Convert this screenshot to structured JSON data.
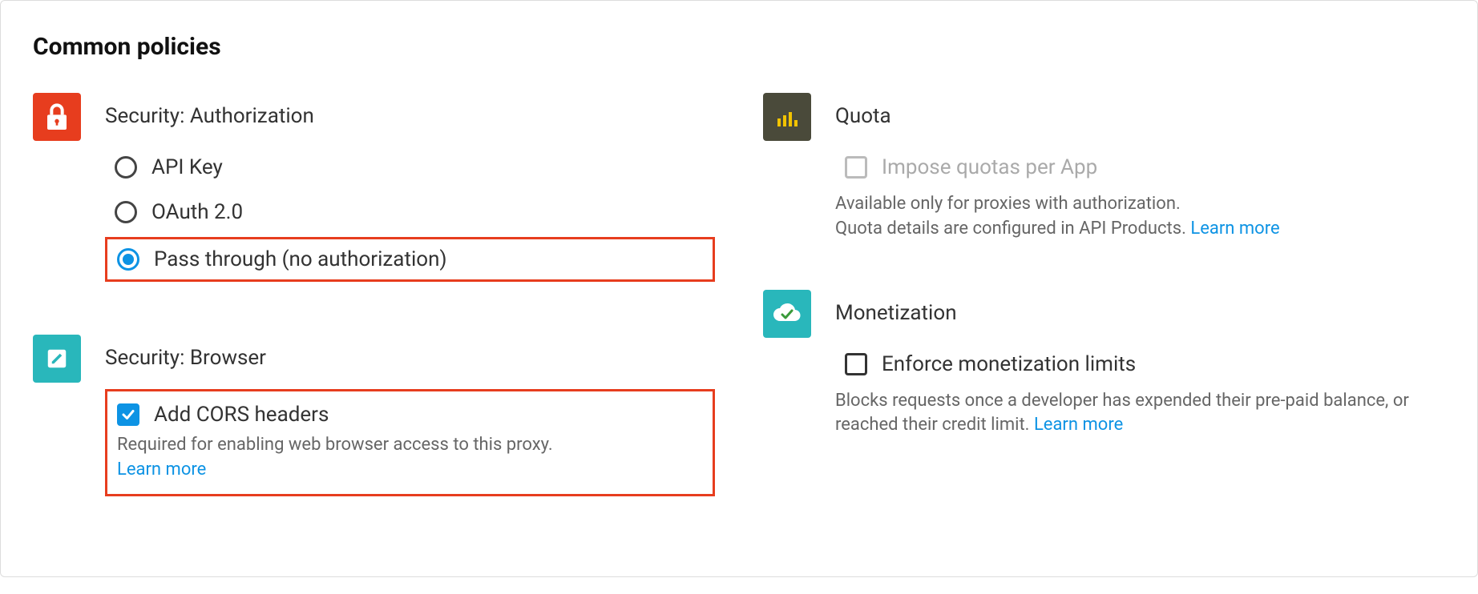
{
  "section_title": "Common policies",
  "security_auth": {
    "title": "Security: Authorization",
    "options": [
      {
        "label": "API Key"
      },
      {
        "label": "OAuth 2.0"
      },
      {
        "label": "Pass through (no authorization)"
      }
    ]
  },
  "security_browser": {
    "title": "Security: Browser",
    "checkbox_label": "Add CORS headers",
    "help_text": "Required for enabling web browser access to this proxy.",
    "learn_more": "Learn more"
  },
  "quota": {
    "title": "Quota",
    "checkbox_label": "Impose quotas per App",
    "help_line1": "Available only for proxies with authorization.",
    "help_line2": "Quota details are configured in API Products. ",
    "learn_more": "Learn more"
  },
  "monetization": {
    "title": "Monetization",
    "checkbox_label": "Enforce monetization limits",
    "help_text": "Blocks requests once a developer has expended their pre-paid balance, or reached their credit limit. ",
    "learn_more": "Learn more"
  }
}
